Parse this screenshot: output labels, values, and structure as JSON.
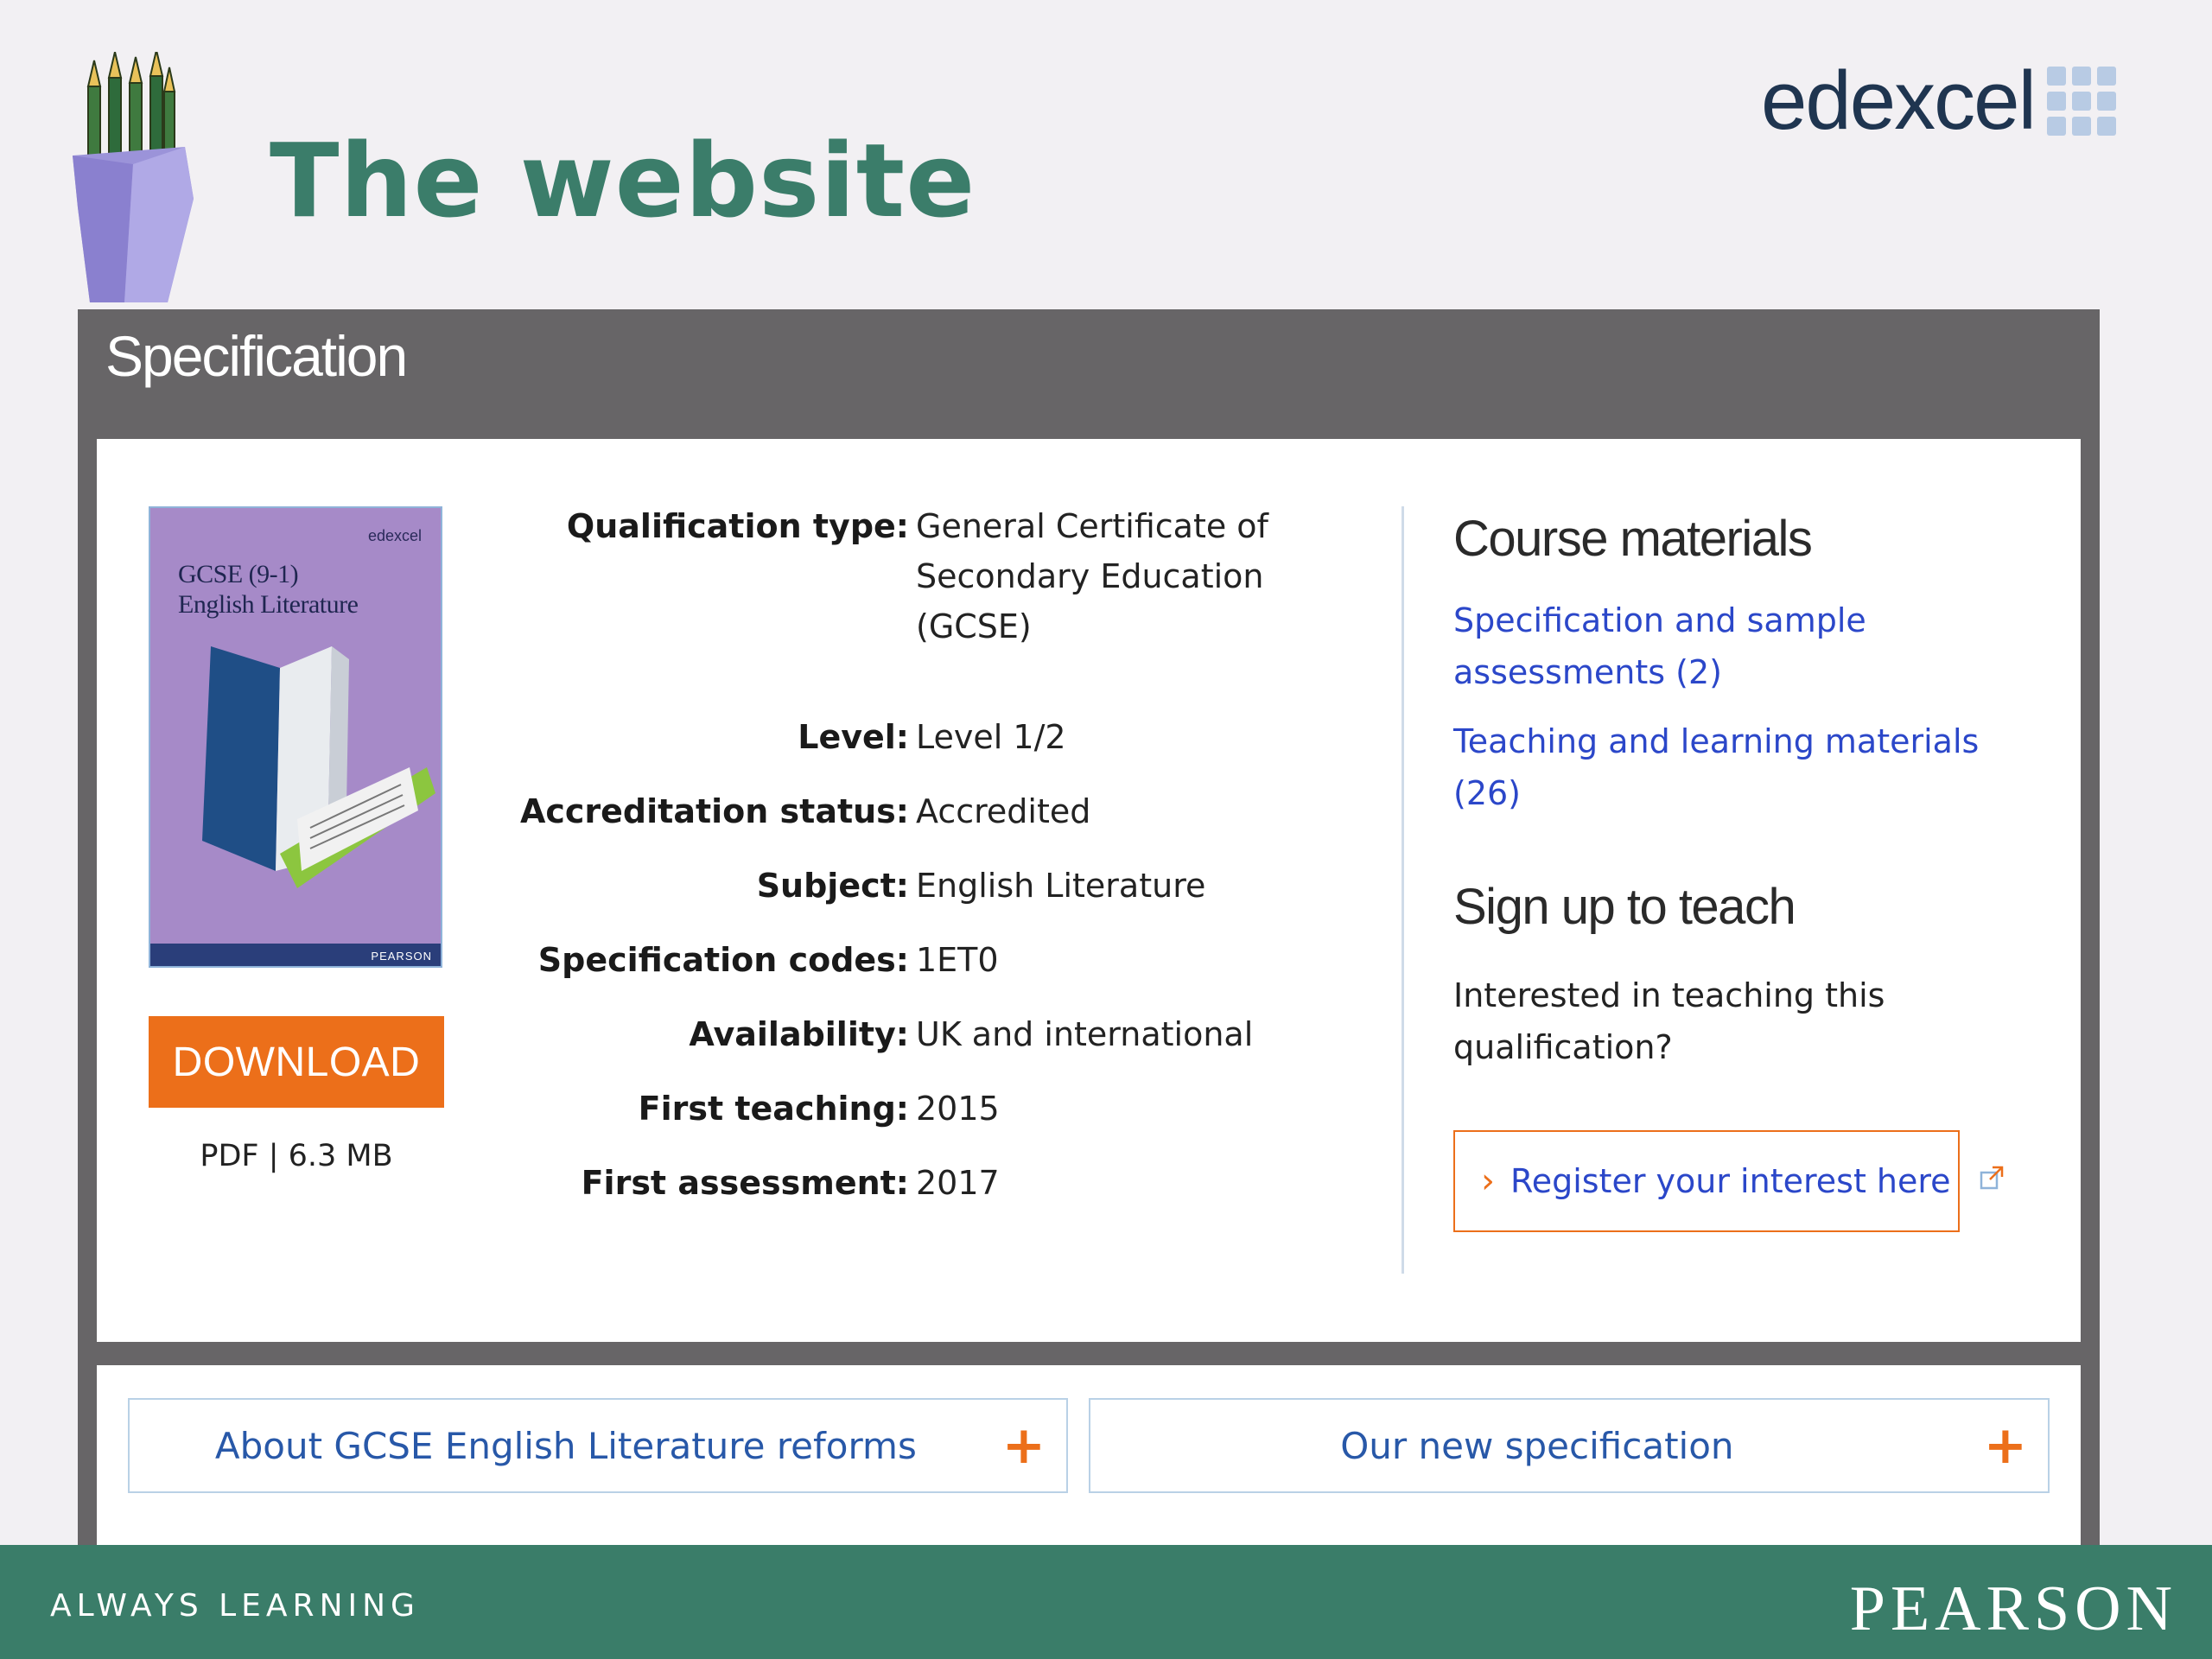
{
  "slide": {
    "title": "The website",
    "brand": "edexcel"
  },
  "spec": {
    "heading": "Specification",
    "cover": {
      "brand": "edexcel",
      "title_line1": "GCSE (9-1)",
      "title_line2": "English Literature",
      "publisher": "PEARSON"
    },
    "download_label": "DOWNLOAD",
    "file_meta": "PDF | 6.3 MB",
    "details": [
      {
        "label": "Qualification type:",
        "value_lines": [
          "General Certificate of",
          "Secondary Education",
          "(GCSE)"
        ]
      },
      {
        "label": "Level:",
        "value_lines": [
          "Level 1/2"
        ]
      },
      {
        "label": "Accreditation status:",
        "value_lines": [
          "Accredited"
        ]
      },
      {
        "label": "Subject:",
        "value_lines": [
          "English Literature"
        ]
      },
      {
        "label": "Specification codes:",
        "value_lines": [
          "1ET0"
        ]
      },
      {
        "label": "Availability:",
        "value_lines": [
          "UK and international"
        ]
      },
      {
        "label": "First teaching:",
        "value_lines": [
          "2015"
        ]
      },
      {
        "label": "First assessment:",
        "value_lines": [
          "2017"
        ]
      }
    ]
  },
  "course_materials": {
    "heading": "Course materials",
    "link1_line1": "Specification and sample",
    "link1_line2": "assessments (2)",
    "link2_line1": "Teaching and learning materials",
    "link2_line2": "(26)"
  },
  "sign_up": {
    "heading": "Sign up to teach",
    "text_line1": "Interested in teaching this",
    "text_line2": "qualification?",
    "button_label": "Register your interest here"
  },
  "accordions": [
    {
      "label": "About GCSE English Literature reforms"
    },
    {
      "label": "Our new specification"
    }
  ],
  "footer": {
    "tagline": "ALWAYS LEARNING",
    "brand": "PEARSON"
  },
  "colors": {
    "title_green": "#3b7d6a",
    "accent_orange": "#ec6f1a",
    "link_blue": "#2b47c9",
    "frame_grey": "#676567"
  }
}
